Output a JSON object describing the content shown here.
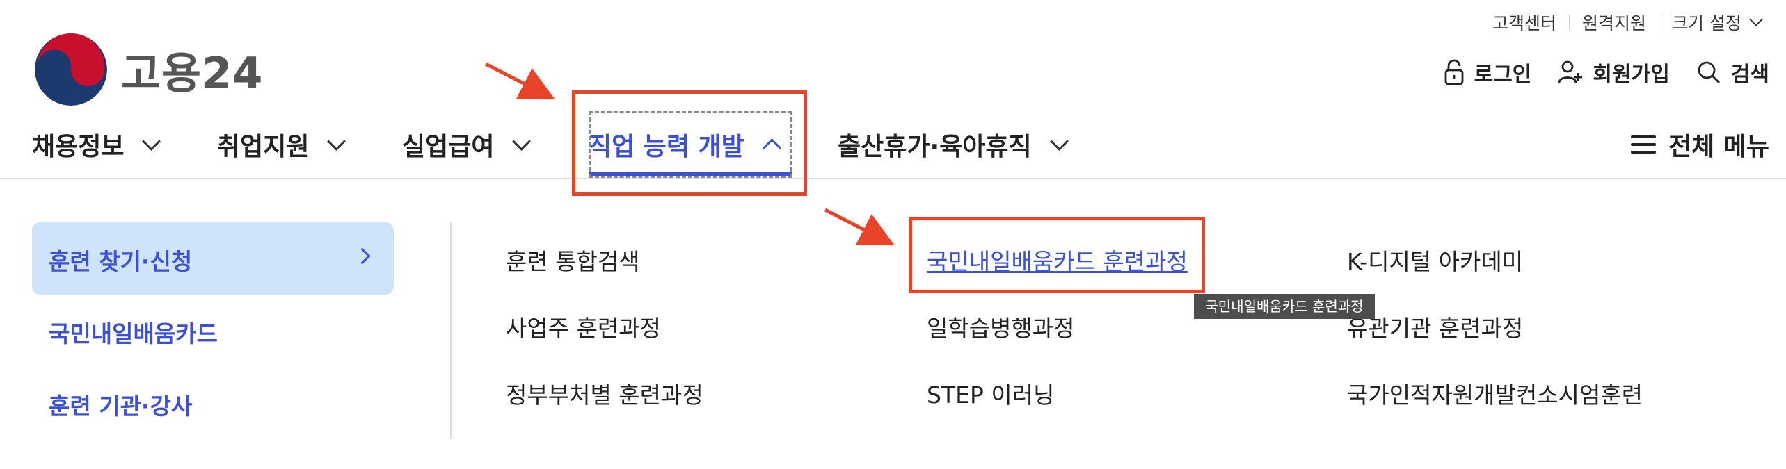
{
  "utility": {
    "customer_center": "고객센터",
    "remote_support": "원격지원",
    "size_setting": "크기 설정"
  },
  "logo": {
    "text": "고용24"
  },
  "actions": {
    "login": "로그인",
    "signup": "회원가입",
    "search": "검색"
  },
  "gnb": {
    "items": [
      {
        "label": "채용정보"
      },
      {
        "label": "취업지원"
      },
      {
        "label": "실업급여"
      },
      {
        "label": "직업 능력 개발"
      },
      {
        "label": "출산휴가·육아휴직"
      }
    ],
    "all_menu": "전체 메뉴"
  },
  "submenu": {
    "side": [
      {
        "label": "훈련 찾기·신청"
      },
      {
        "label": "국민내일배움카드"
      },
      {
        "label": "훈련 기관·강사"
      }
    ],
    "links": [
      {
        "label": "훈련 통합검색"
      },
      {
        "label": "국민내일배움카드 훈련과정"
      },
      {
        "label": "K-디지털 아카데미"
      },
      {
        "label": "사업주 훈련과정"
      },
      {
        "label": "일학습병행과정"
      },
      {
        "label": "유관기관 훈련과정"
      },
      {
        "label": "정부부처별 훈련과정"
      },
      {
        "label": "STEP 이러닝"
      },
      {
        "label": "국가인적자원개발컨소시엄훈련"
      }
    ],
    "tooltip": "국민내일배움카드 훈련과정"
  },
  "colors": {
    "accent": "#3b4fd8",
    "annotation": "#e8442a",
    "active_bg": "#cfe3fb"
  }
}
